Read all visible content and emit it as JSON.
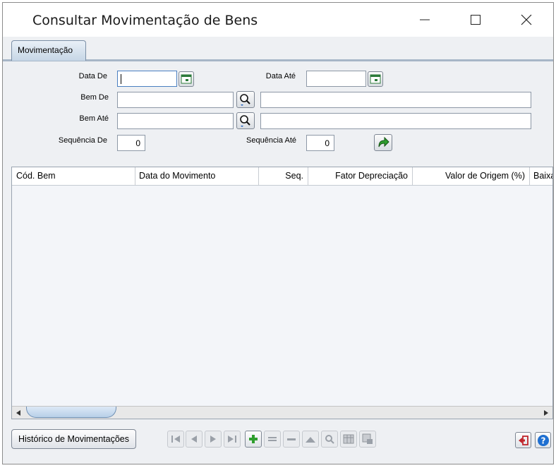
{
  "window": {
    "title": "Consultar Movimentação de Bens",
    "controls": [
      "minimize-icon",
      "maximize-icon",
      "close-icon"
    ]
  },
  "tabs": [
    {
      "label": "Movimentação",
      "active": true
    }
  ],
  "filters": {
    "data_de": {
      "label": "Data De",
      "value": ""
    },
    "data_ate": {
      "label": "Data Até",
      "value": ""
    },
    "bem_de": {
      "label": "Bem De",
      "value": "",
      "description": ""
    },
    "bem_ate": {
      "label": "Bem Até",
      "value": "",
      "description": ""
    },
    "sequencia_de": {
      "label": "Sequência De",
      "value": "0"
    },
    "sequencia_ate": {
      "label": "Sequência Até",
      "value": "0"
    }
  },
  "grid": {
    "columns": [
      "Cód. Bem",
      "Data do Movimento",
      "Seq.",
      "Fator Depreciação",
      "Valor de Origem (%)",
      "Baixa"
    ],
    "rows": []
  },
  "footer": {
    "historico_label": "Histórico de Movimentações",
    "nav_icons": [
      "first-icon",
      "prev-icon",
      "next-icon",
      "last-icon",
      "add-icon",
      "edit-icon",
      "remove-icon",
      "up-icon",
      "search-icon",
      "table-icon",
      "export-icon"
    ],
    "right_icons": [
      "exit-icon",
      "help-icon"
    ]
  },
  "colors": {
    "accent_green": "#2e9e2e",
    "exit_red": "#c0262c",
    "help_blue": "#1e6fd1"
  }
}
